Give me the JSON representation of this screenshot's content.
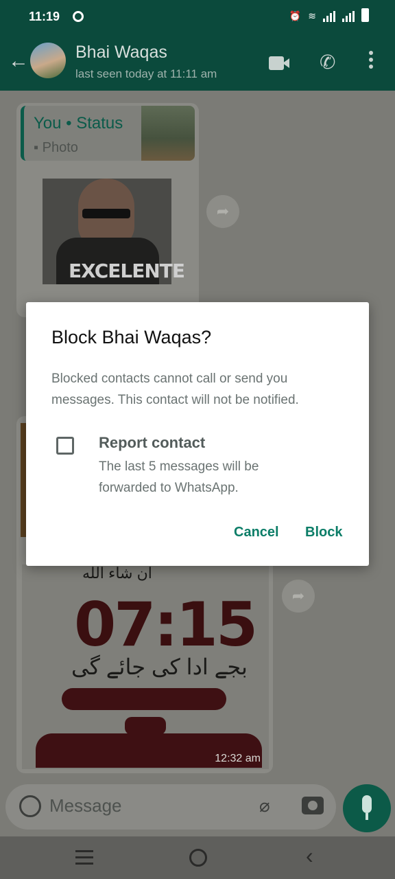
{
  "status_bar": {
    "time": "11:19"
  },
  "header": {
    "contact_name": "Bhai Waqas",
    "last_seen": "last seen today at 11:11 am"
  },
  "chat": {
    "quoted": {
      "author": "You • Status",
      "type": "Photo"
    },
    "sticker_text": "EXCELENTE",
    "poster": {
      "top_text": "ان شاء الله",
      "time": "07:15",
      "urdu_line": "بجے ادا کی جائے گی"
    },
    "message_time": "12:32 am"
  },
  "composer": {
    "placeholder": "Message"
  },
  "dialog": {
    "title": "Block Bhai Waqas?",
    "body": "Blocked contacts cannot call or send you messages. This contact will not be notified.",
    "checkbox_label": "Report contact",
    "checkbox_desc": "The last 5 messages will be forwarded to WhatsApp.",
    "checkbox_checked": false,
    "cancel_label": "Cancel",
    "block_label": "Block"
  },
  "colors": {
    "header": "#0b4a3c",
    "accent": "#0b7d67"
  }
}
